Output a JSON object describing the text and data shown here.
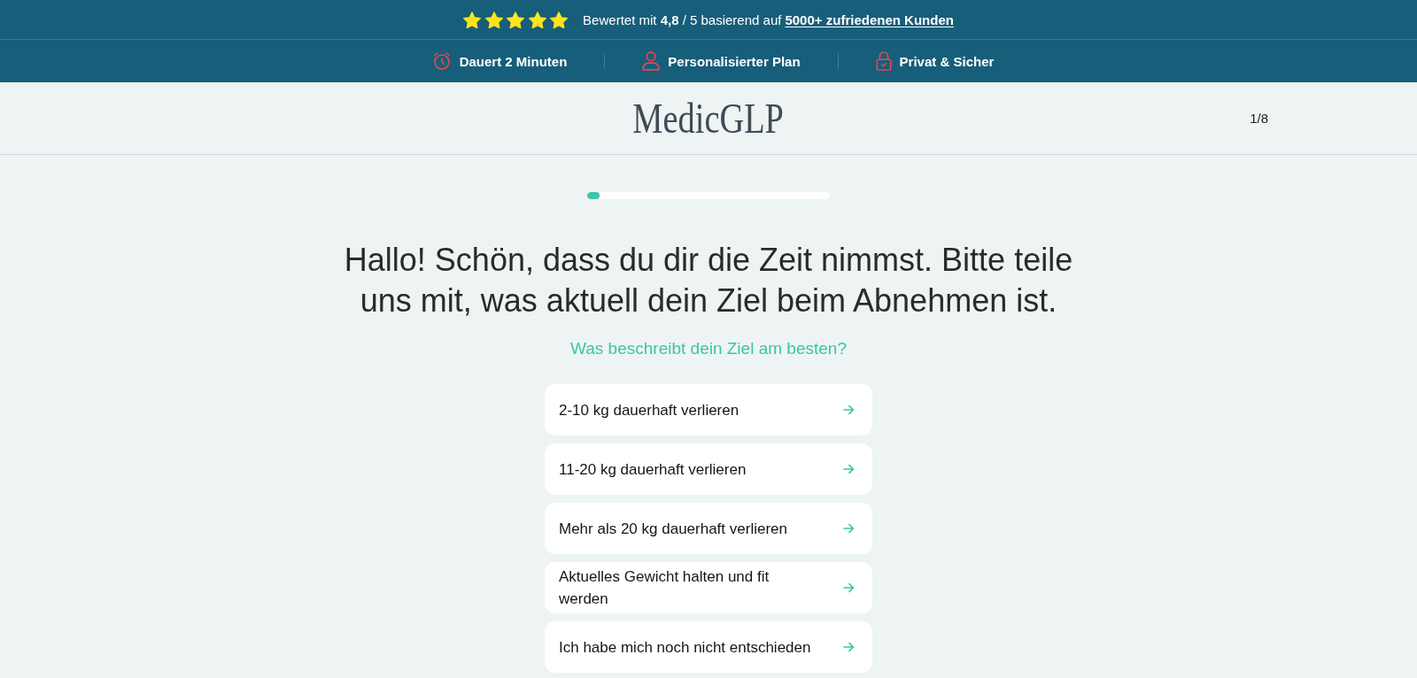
{
  "rating_bar": {
    "stars": 5,
    "text": "Bewertet mit **4,8** / 5 basierend auf",
    "link": "5000+ zufriedenen Kunden"
  },
  "features": [
    {
      "label": "Dauert 2 Minuten"
    },
    {
      "label": "Personalisierter Plan"
    },
    {
      "label": "Privat & Sicher"
    }
  ],
  "header": {
    "logo": "MedicGLP",
    "step": "1/8"
  },
  "progress": {
    "level": 0.05
  },
  "question": {
    "title": "Hallo! Schön, dass du dir die Zeit nimmst. Bitte teile uns mit, was aktuell dein Ziel beim Abnehmen ist.",
    "subtitle": "Was beschreibt dein Ziel am besten?",
    "options": [
      {
        "label": "2-10 kg dauerhaft verlieren"
      },
      {
        "label": "11-20 kg dauerhaft verlieren"
      },
      {
        "label": "Mehr als 20 kg dauerhaft verlieren"
      },
      {
        "label": "Aktuelles Gewicht halten und fit werden"
      },
      {
        "label": "Ich habe mich noch nicht entschieden"
      }
    ]
  }
}
